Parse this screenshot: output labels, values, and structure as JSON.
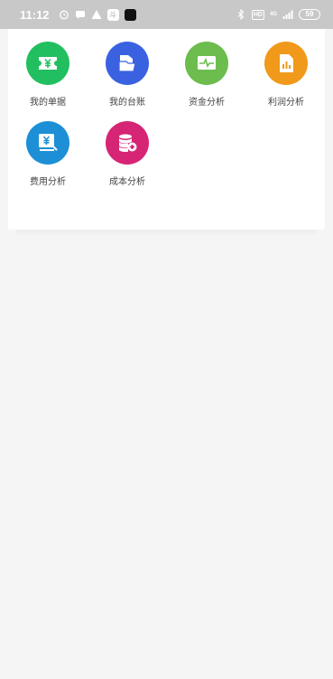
{
  "status_bar": {
    "time": "11:12",
    "app_badge": "斗",
    "network_hd": "HD",
    "network_type": "4G",
    "battery": "59"
  },
  "menu": {
    "items": [
      {
        "label": "我的单据",
        "icon": "ticket-yen-icon",
        "color": "#22bf60"
      },
      {
        "label": "我的台账",
        "icon": "folder-icon",
        "color": "#3a62e0"
      },
      {
        "label": "资金分析",
        "icon": "pulse-monitor-icon",
        "color": "#6cbd4e"
      },
      {
        "label": "利润分析",
        "icon": "report-chart-icon",
        "color": "#f0991a"
      },
      {
        "label": "费用分析",
        "icon": "invoice-yen-icon",
        "color": "#1d8fd7"
      },
      {
        "label": "成本分析",
        "icon": "coin-stack-icon",
        "color": "#d62574"
      }
    ]
  }
}
